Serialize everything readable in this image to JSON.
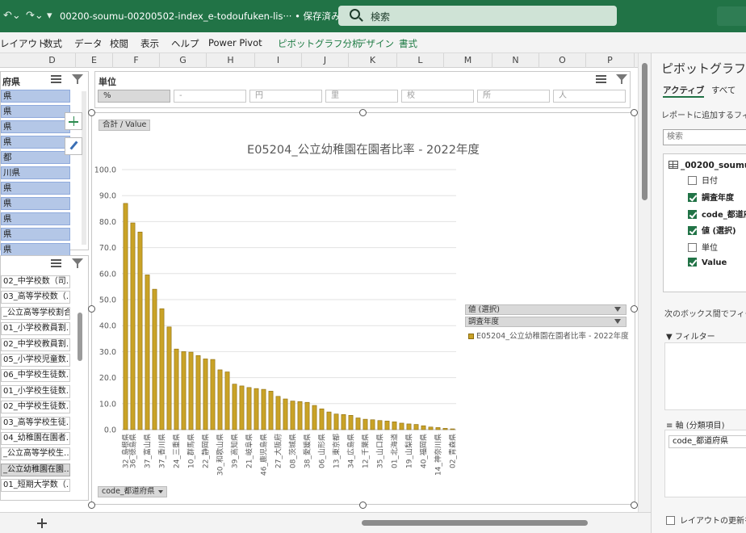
{
  "titlebar": {
    "document_title": "00200-soumu-00200502-index_e-todoufuken-lis···",
    "save_status": "• 保存済み ⌄",
    "search_label": "検索"
  },
  "ribbon_tabs": [
    "レイアウト",
    "数式",
    "データ",
    "校閲",
    "表示",
    "ヘルプ",
    "Power Pivot",
    "ピボットグラフ分析",
    "デザイン",
    "書式"
  ],
  "columns": [
    "D",
    "E",
    "F",
    "G",
    "H",
    "I",
    "J",
    "K",
    "L",
    "M",
    "N",
    "O",
    "P"
  ],
  "slicer_prefecture": {
    "header": "府県",
    "items": [
      "県",
      "県",
      "県",
      "県",
      "都",
      "川県",
      "県",
      "県",
      "県",
      "県",
      "県"
    ]
  },
  "slicer_indicator": {
    "items": [
      "02_中学校数（司…",
      "03_高等学校数（…",
      "_公立高等学校割合",
      "01_小学校教員割…",
      "02_中学校教員割…",
      "05_小学校児童数…",
      "06_中学校生徒数…",
      "01_小学校生徒数…",
      "02_中学校生徒数…",
      "03_高等学校生徒…",
      "04_幼稚園在園者…",
      "_公立高等学校生…",
      "_公立幼稚園在園…",
      "01_短期大学数（…"
    ],
    "selected_index": 12
  },
  "slicer_unit": {
    "header": "単位",
    "items": [
      "%",
      "-",
      "円",
      "里",
      "校",
      "所",
      "人"
    ],
    "selected_index": 0
  },
  "chart": {
    "sum_button": "合計 / Value",
    "axis_button": "code_都道府県",
    "legend_field1": "値 (選択)",
    "legend_field2": "調査年度",
    "legend_entry": "E05204_公立幼稚園在園者比率 - 2022年度"
  },
  "chart_data": {
    "type": "bar",
    "title": "E05204_公立幼稚園在園者比率 - 2022年度",
    "ylim": [
      0,
      100
    ],
    "yticks": [
      "0.0",
      "10.0",
      "20.0",
      "30.0",
      "40.0",
      "50.0",
      "60.0",
      "70.0",
      "80.0",
      "90.0",
      "100.0"
    ],
    "categories": [
      "32_島根県",
      "36_徳島県",
      "",
      "37_富山県",
      "",
      "37_香川県",
      "",
      "24_三重県",
      "",
      "10_群馬県",
      "",
      "22_静岡県",
      "",
      "30_和歌山県",
      "",
      "39_高知県",
      "",
      "21_岐阜県",
      "",
      "46_鹿児島県",
      "",
      "27_大阪府",
      "",
      "08_茨城県",
      "",
      "38_愛媛県",
      "",
      "06_山形県",
      "",
      "13_東京都",
      "",
      "34_広島県",
      "",
      "12_千葉県",
      "",
      "35_山口県",
      "",
      "01_北海道",
      "",
      "19_山梨県",
      "",
      "40_福岡県",
      "",
      "14_神奈川県",
      "",
      "02_青森県"
    ],
    "values": [
      87.0,
      79.5,
      76.0,
      59.5,
      54.0,
      46.5,
      39.5,
      31.0,
      30.0,
      29.8,
      28.5,
      27.2,
      27.0,
      23.0,
      22.2,
      17.5,
      16.8,
      16.2,
      15.8,
      15.5,
      14.8,
      12.8,
      11.8,
      11.0,
      10.8,
      10.5,
      9.3,
      8.0,
      6.8,
      6.0,
      5.8,
      5.5,
      4.5,
      4.0,
      3.8,
      3.5,
      3.3,
      3.0,
      2.5,
      2.2,
      2.0,
      1.5,
      1.0,
      0.8,
      0.5,
      0.3
    ],
    "bar_color": "#c9a227",
    "grid": true,
    "legend_position": "right"
  },
  "panel": {
    "title": "ピボットグラフの",
    "tab_active": "アクティブ",
    "tab_all": "すべて",
    "hint": "レポートに追加するフィール",
    "search_placeholder": "検索",
    "table_name": "_00200_soumu",
    "fields": [
      {
        "label": "日付",
        "checked": false
      },
      {
        "label": "調査年度",
        "checked": true
      },
      {
        "label": "code_都道府",
        "checked": true
      },
      {
        "label": "値 (選択)",
        "checked": true
      },
      {
        "label": "単位",
        "checked": false
      },
      {
        "label": "Value",
        "checked": true
      }
    ],
    "drag_hint": "次のボックス間でフィールド",
    "filter_label": "フィルター",
    "axis_label": "軸 (分類項目)",
    "axis_field": "code_都道府県",
    "defer_label": "レイアウトの更新を保"
  },
  "colors": {
    "excel_green": "#217346",
    "bar": "#c9a227",
    "slicer_selected": "#b4c7e7"
  }
}
